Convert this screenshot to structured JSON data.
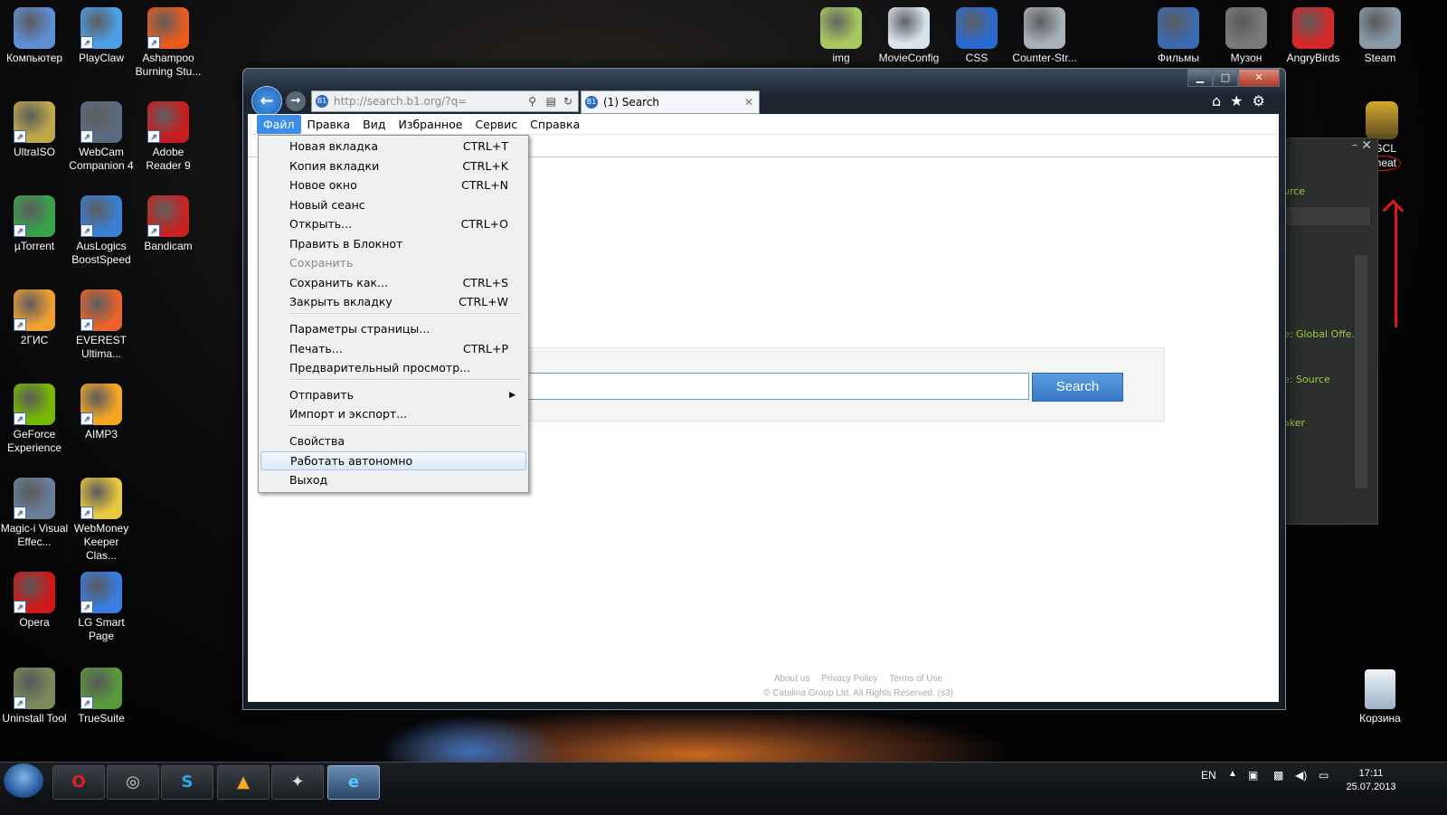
{
  "desktop": {
    "left_icons": [
      {
        "label": "Компьютер",
        "icon": "computer-icon",
        "color": "#5d8fd3"
      },
      {
        "label": "PlayClaw",
        "icon": "playclaw-icon",
        "color": "#4aa0e8"
      },
      {
        "label": "Ashampoo Burning Stu...",
        "icon": "ashampoo-icon",
        "color": "#e85c1c"
      },
      {
        "label": "UltraISO",
        "icon": "ultraiso-icon",
        "color": "#c0a84a"
      },
      {
        "label": "WebCam Companion 4",
        "icon": "webcam-icon",
        "color": "#5a6a80"
      },
      {
        "label": "Adobe Reader 9",
        "icon": "adobe-reader-icon",
        "color": "#c91d1d"
      },
      {
        "label": "µTorrent",
        "icon": "utorrent-icon",
        "color": "#3aa34a"
      },
      {
        "label": "AusLogics BoostSpeed",
        "icon": "auslogics-icon",
        "color": "#3b7fd3"
      },
      {
        "label": "Bandicam",
        "icon": "bandicam-icon",
        "color": "#c82222"
      },
      {
        "label": "2ГИС",
        "icon": "2gis-icon",
        "color": "#f0a030"
      },
      {
        "label": "EVEREST Ultima...",
        "icon": "everest-icon",
        "color": "#e8642a"
      },
      {
        "label": "GeForce Experience",
        "icon": "geforce-icon",
        "color": "#76b900"
      },
      {
        "label": "AIMP3",
        "icon": "aimp-icon",
        "color": "#f5a623"
      },
      {
        "label": "Magic-i Visual Effec...",
        "icon": "magic-i-icon",
        "color": "#6a7f9a"
      },
      {
        "label": "WebMoney Keeper Clas...",
        "icon": "webmoney-icon",
        "color": "#e8c840"
      },
      {
        "label": "Opera",
        "icon": "opera-icon",
        "color": "#d01818"
      },
      {
        "label": "LG Smart Page",
        "icon": "lg-smart-page-icon",
        "color": "#3a7de0"
      },
      {
        "label": "Uninstall Tool",
        "icon": "uninstall-tool-icon",
        "color": "#7a8a5a"
      },
      {
        "label": "TrueSuite",
        "icon": "truesuite-icon",
        "color": "#5a9a3a"
      }
    ],
    "top_icons": [
      {
        "label": "img",
        "icon": "image-folder-icon",
        "color": "#a8c860"
      },
      {
        "label": "MovieConfig",
        "icon": "config-file-icon",
        "color": "#d8e4ee"
      },
      {
        "label": "CSS",
        "icon": "css-icon",
        "color": "#2a6ad0"
      },
      {
        "label": "Counter-Str...",
        "icon": "counter-strike-icon",
        "color": "#a8b0b8"
      },
      {
        "label": "Фильмы",
        "icon": "movies-folder-icon",
        "color": "#3a6ab0"
      },
      {
        "label": "Музон",
        "icon": "music-folder-icon",
        "color": "#7a7a7a"
      },
      {
        "label": "AngryBirds",
        "icon": "angrybirds-icon",
        "color": "#d62828"
      },
      {
        "label": "Steam",
        "icon": "steam-icon",
        "color": "#8a9aa8"
      }
    ],
    "fgcl_icon": {
      "label1": "FGCL",
      "label2": "Cheat"
    },
    "recycle_bin": {
      "label": "Корзина"
    }
  },
  "browser": {
    "address": "http://search.b1.org/?q=",
    "tab_title": "(1) Search",
    "tab_favicon": "B1",
    "menu": [
      "Файл",
      "Правка",
      "Вид",
      "Избранное",
      "Сервис",
      "Справка"
    ],
    "search_button": "Search",
    "footer_links": [
      "About us",
      "Privacy Policy",
      "Terms of Use"
    ],
    "copyright": "© Catalina Group Ltd. All Rights Reserved. (s3)"
  },
  "file_menu": {
    "items": [
      {
        "label": "Новая вкладка",
        "shortcut": "CTRL+T"
      },
      {
        "label": "Копия вкладки",
        "shortcut": "CTRL+K"
      },
      {
        "label": "Новое окно",
        "shortcut": "CTRL+N"
      },
      {
        "label": "Новый сеанс",
        "shortcut": ""
      },
      {
        "label": "Открыть...",
        "shortcut": "CTRL+O"
      },
      {
        "label": "Править в Блокнот",
        "shortcut": ""
      },
      {
        "label": "Сохранить",
        "shortcut": "",
        "disabled": true
      },
      {
        "label": "Сохранить как...",
        "shortcut": "CTRL+S"
      },
      {
        "label": "Закрыть вкладку",
        "shortcut": "CTRL+W"
      },
      {
        "label": "Параметры страницы...",
        "shortcut": ""
      },
      {
        "label": "Печать...",
        "shortcut": "CTRL+P"
      },
      {
        "label": "Предварительный просмотр...",
        "shortcut": ""
      },
      {
        "label": "Отправить",
        "shortcut": "",
        "submenu": true
      },
      {
        "label": "Импорт и экспорт...",
        "shortcut": ""
      },
      {
        "label": "Свойства",
        "shortcut": ""
      },
      {
        "label": "Работать автономно",
        "shortcut": "",
        "highlighted": true
      },
      {
        "label": "Выход",
        "shortcut": ""
      }
    ]
  },
  "side_window": {
    "lines": [
      "urce",
      "e: Global Offe...",
      "e: Source",
      "aker"
    ]
  },
  "taskbar": {
    "buttons": [
      {
        "name": "opera-taskbar-button",
        "icon": "opera-icon"
      },
      {
        "name": "steam-taskbar-button",
        "icon": "steam-icon"
      },
      {
        "name": "skype-taskbar-button",
        "icon": "skype-icon"
      },
      {
        "name": "aimp-taskbar-button",
        "icon": "aimp-icon"
      },
      {
        "name": "counter-strike-taskbar-button",
        "icon": "counter-strike-icon"
      },
      {
        "name": "ie-taskbar-button",
        "icon": "internet-explorer-icon"
      }
    ],
    "language": "EN",
    "time": "17:11",
    "date": "25.07.2013"
  }
}
